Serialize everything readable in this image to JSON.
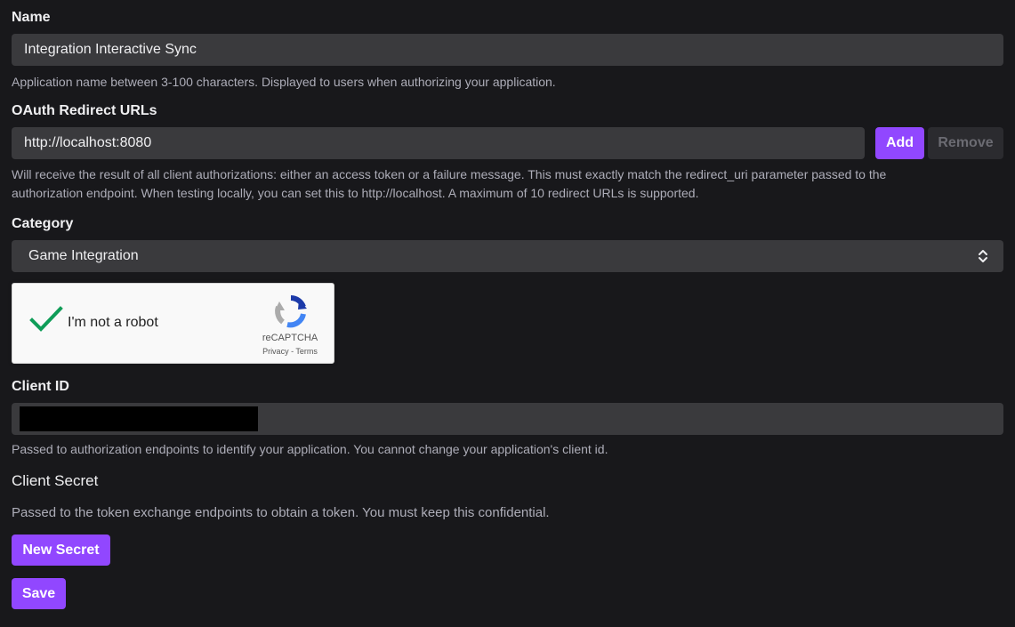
{
  "name_section": {
    "label": "Name",
    "value": "Integration Interactive Sync",
    "help": "Application name between 3-100 characters. Displayed to users when authorizing your application."
  },
  "redirect_section": {
    "label": "OAuth Redirect URLs",
    "value": "http://localhost:8080",
    "add_label": "Add",
    "remove_label": "Remove",
    "help_line1": "Will receive the result of all client authorizations: either an access token or a failure message. This must exactly match the redirect_uri parameter passed to the",
    "help_line2": "authorization endpoint. When testing locally, you can set this to http://localhost. A maximum of 10 redirect URLs is supported."
  },
  "category_section": {
    "label": "Category",
    "selected": "Game Integration",
    "icon": "chevron-up-down-icon"
  },
  "recaptcha": {
    "label": "I'm not a robot",
    "brand": "reCAPTCHA",
    "privacy": "Privacy",
    "separator": " - ",
    "terms": "Terms",
    "checked": true,
    "check_color": "#0f9d58"
  },
  "client_id_section": {
    "label": "Client ID",
    "help": "Passed to authorization endpoints to identify your application. You cannot change your application's client id."
  },
  "client_secret_section": {
    "label": "Client Secret",
    "help": "Passed to the token exchange endpoints to obtain a token. You must keep this confidential.",
    "new_secret_label": "New Secret"
  },
  "save_label": "Save",
  "colors": {
    "background": "#18181b",
    "input_bg": "#3a3a3d",
    "accent": "#9147ff",
    "help_text": "#adadb8"
  }
}
